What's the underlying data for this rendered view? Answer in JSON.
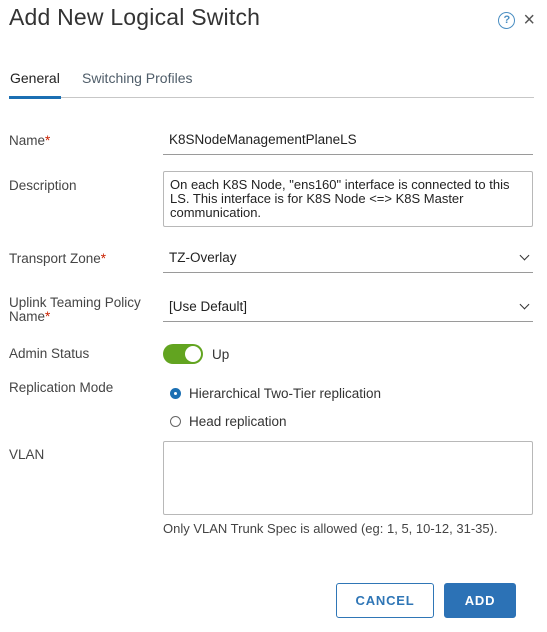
{
  "dialog": {
    "title": "Add New Logical Switch",
    "help_icon_glyph": "?",
    "close_icon_glyph": "×"
  },
  "tabs": [
    {
      "label": "General",
      "active": true
    },
    {
      "label": "Switching Profiles",
      "active": false
    }
  ],
  "form": {
    "required_marker": "*",
    "name": {
      "label": "Name",
      "value": "K8SNodeManagementPlaneLS"
    },
    "description": {
      "label": "Description",
      "value": "On each K8S Node, \"ens160\" interface is connected to this LS. This interface is for K8S Node <=> K8S Master communication."
    },
    "transport_zone": {
      "label": "Transport Zone",
      "value": "TZ-Overlay"
    },
    "uplink_teaming_policy": {
      "label_line1": "Uplink Teaming Policy",
      "label_line2": "Name",
      "value": "[Use Default]"
    },
    "admin_status": {
      "label": "Admin Status",
      "value": "Up",
      "enabled": true
    },
    "replication_mode": {
      "label": "Replication Mode",
      "options": [
        {
          "label": "Hierarchical Two-Tier replication",
          "selected": true
        },
        {
          "label": "Head replication",
          "selected": false
        }
      ]
    },
    "vlan": {
      "label": "VLAN",
      "value": "",
      "hint": "Only VLAN Trunk Spec is allowed (eg: 1, 5, 10-12, 31-35)."
    }
  },
  "buttons": {
    "cancel": "CANCEL",
    "add": "ADD"
  },
  "colors": {
    "accent": "#1b6fb3",
    "required": "#c92100",
    "toggle_on": "#62a420"
  }
}
